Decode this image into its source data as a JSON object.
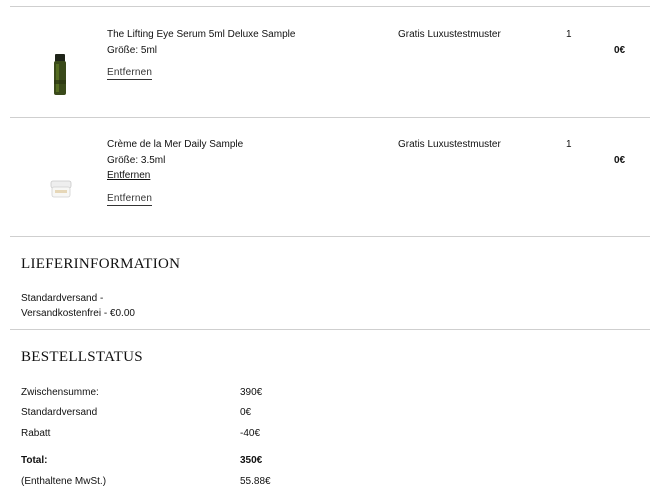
{
  "cart": {
    "items": [
      {
        "name": "The Lifting Eye Serum 5ml Deluxe Sample",
        "size": "Größe: 5ml",
        "remove_label": "Entfernen",
        "type": "Gratis Luxustestmuster",
        "quantity": "1",
        "price": "0€"
      },
      {
        "name": "Crème de la Mer Daily Sample",
        "size": "Größe: 3.5ml",
        "remove_label_inline": "Entfernen",
        "remove_label": "Entfernen",
        "type": "Gratis Luxustestmuster",
        "quantity": "1",
        "price": "0€"
      }
    ]
  },
  "delivery": {
    "title": "LIEFERINFORMATION",
    "line1": "Standardversand -",
    "line2": "Versandkostenfrei - €0.00"
  },
  "order_status": {
    "title": "BESTELLSTATUS",
    "rows": [
      {
        "label": "Zwischensumme:",
        "value": "390€"
      },
      {
        "label": "Standardversand",
        "value": "0€"
      },
      {
        "label": "Rabatt",
        "value": "-40€"
      },
      {
        "label": "Total:",
        "value": "350€"
      },
      {
        "label": "(Enthaltene MwSt.)",
        "value": "55.88€"
      }
    ]
  }
}
